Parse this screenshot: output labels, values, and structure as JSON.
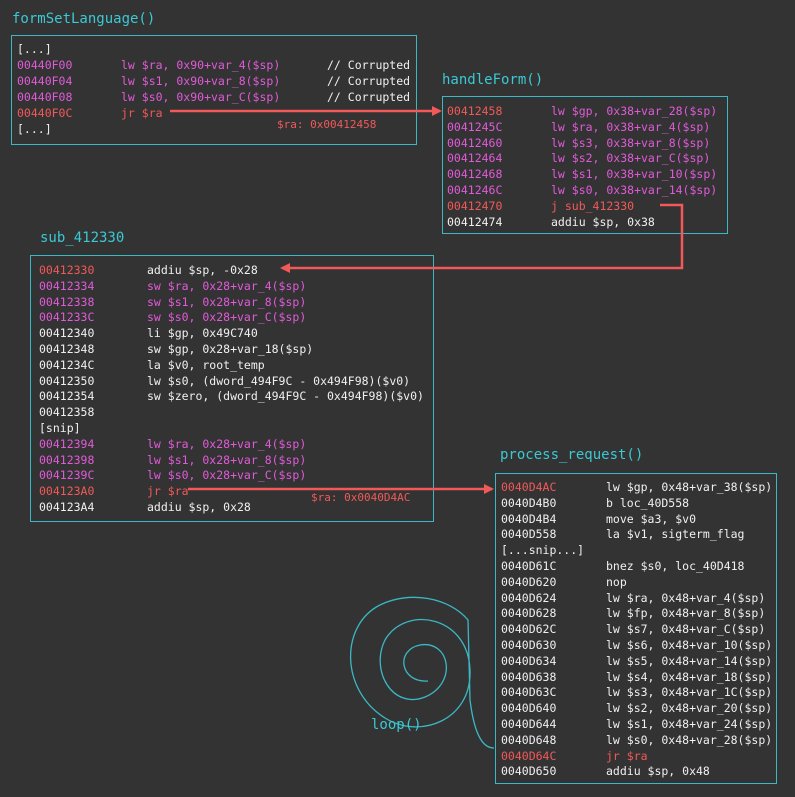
{
  "colors": {
    "white": "#f0f0f0",
    "pink": "#e15bd9",
    "red": "#f25959",
    "cyan": "#3bc9d4",
    "background": "#333333"
  },
  "blocks": {
    "formSetLanguage": {
      "title": "formSetLanguage()",
      "lines": [
        {
          "addr": "[...]",
          "instr": "",
          "color": "white"
        },
        {
          "addr": "00440F00",
          "instr": "lw $ra, 0x90+var_4($sp)",
          "color": "pink",
          "comment": "// Corrupted"
        },
        {
          "addr": "00440F04",
          "instr": "lw $s1, 0x90+var_8($sp)",
          "color": "pink",
          "comment": "// Corrupted"
        },
        {
          "addr": "00440F08",
          "instr": "lw $s0, 0x90+var_C($sp)",
          "color": "pink",
          "comment": "// Corrupted"
        },
        {
          "addr": "00440F0C",
          "instr": "jr $ra",
          "color": "red"
        },
        {
          "addr": "[...]",
          "instr": "",
          "color": "white"
        }
      ],
      "ra_label": "$ra: 0x00412458"
    },
    "handleForm": {
      "title": "handleForm()",
      "lines": [
        {
          "addr": "00412458",
          "instr": "lw $gp, 0x38+var_28($sp)",
          "color": "pink",
          "addr_color": "red"
        },
        {
          "addr": "0041245C",
          "instr": "lw $ra, 0x38+var_4($sp)",
          "color": "pink"
        },
        {
          "addr": "00412460",
          "instr": "lw $s3, 0x38+var_8($sp)",
          "color": "pink"
        },
        {
          "addr": "00412464",
          "instr": "lw $s2, 0x38+var_C($sp)",
          "color": "pink"
        },
        {
          "addr": "00412468",
          "instr": "lw $s1, 0x38+var_10($sp)",
          "color": "pink"
        },
        {
          "addr": "0041246C",
          "instr": "lw $s0, 0x38+var_14($sp)",
          "color": "pink"
        },
        {
          "addr": "00412470",
          "instr": "j sub_412330",
          "color": "red"
        },
        {
          "addr": "00412474",
          "instr": "addiu $sp, 0x38",
          "color": "white"
        }
      ]
    },
    "sub_412330": {
      "title": "sub_412330",
      "lines": [
        {
          "addr": "00412330",
          "instr": "addiu $sp, -0x28",
          "color": "white",
          "addr_color": "red"
        },
        {
          "addr": "00412334",
          "instr": "sw $ra, 0x28+var_4($sp)",
          "color": "pink"
        },
        {
          "addr": "00412338",
          "instr": "sw $s1, 0x28+var_8($sp)",
          "color": "pink"
        },
        {
          "addr": "0041233C",
          "instr": "sw $s0, 0x28+var_C($sp)",
          "color": "pink"
        },
        {
          "addr": "00412340",
          "instr": "li $gp, 0x49C740",
          "color": "white"
        },
        {
          "addr": "00412348",
          "instr": "sw $gp, 0x28+var_18($sp)",
          "color": "white"
        },
        {
          "addr": "0041234C",
          "instr": "la $v0, root_temp",
          "color": "white"
        },
        {
          "addr": "00412350",
          "instr": "lw $s0, (dword_494F9C - 0x494F98)($v0)",
          "color": "white"
        },
        {
          "addr": "00412354",
          "instr": "sw $zero, (dword_494F9C - 0x494F98)($v0)",
          "color": "white"
        },
        {
          "addr": "00412358",
          "instr": "",
          "color": "white"
        },
        {
          "addr": "[snip]",
          "instr": "",
          "color": "white"
        },
        {
          "addr": "00412394",
          "instr": "lw $ra, 0x28+var_4($sp)",
          "color": "pink"
        },
        {
          "addr": "00412398",
          "instr": "lw $s1, 0x28+var_8($sp)",
          "color": "pink"
        },
        {
          "addr": "0041239C",
          "instr": "lw $s0, 0x28+var_C($sp)",
          "color": "pink"
        },
        {
          "addr": "004123A0",
          "instr": "jr $ra",
          "color": "red"
        },
        {
          "addr": "004123A4",
          "instr": "addiu $sp, 0x28",
          "color": "white"
        }
      ],
      "ra_label": "$ra: 0x0040D4AC"
    },
    "process_request": {
      "title": "process_request()",
      "lines": [
        {
          "addr": "0040D4AC",
          "instr": "lw $gp, 0x48+var_38($sp)",
          "color": "white",
          "addr_color": "red"
        },
        {
          "addr": "0040D4B0",
          "instr": "b loc_40D558",
          "color": "white"
        },
        {
          "addr": "0040D4B4",
          "instr": "move $a3, $v0",
          "color": "white"
        },
        {
          "addr": "0040D558",
          "instr": "la $v1, sigterm_flag",
          "color": "white"
        },
        {
          "addr": "[...snip...]",
          "instr": "",
          "color": "white"
        },
        {
          "addr": "0040D61C",
          "instr": "bnez $s0, loc_40D418",
          "color": "white"
        },
        {
          "addr": "0040D620",
          "instr": "nop",
          "color": "white"
        },
        {
          "addr": "0040D624",
          "instr": "lw $ra, 0x48+var_4($sp)",
          "color": "white"
        },
        {
          "addr": "0040D628",
          "instr": "lw $fp, 0x48+var_8($sp)",
          "color": "white"
        },
        {
          "addr": "0040D62C",
          "instr": "lw $s7, 0x48+var_C($sp)",
          "color": "white"
        },
        {
          "addr": "0040D630",
          "instr": "lw $s6, 0x48+var_10($sp)",
          "color": "white"
        },
        {
          "addr": "0040D634",
          "instr": "lw $s5, 0x48+var_14($sp)",
          "color": "white"
        },
        {
          "addr": "0040D638",
          "instr": "lw $s4, 0x48+var_18($sp)",
          "color": "white"
        },
        {
          "addr": "0040D63C",
          "instr": "lw $s3, 0x48+var_1C($sp)",
          "color": "white"
        },
        {
          "addr": "0040D640",
          "instr": "lw $s2, 0x48+var_20($sp)",
          "color": "white"
        },
        {
          "addr": "0040D644",
          "instr": "lw $s1, 0x48+var_24($sp)",
          "color": "white"
        },
        {
          "addr": "0040D648",
          "instr": "lw $s0, 0x48+var_28($sp)",
          "color": "white"
        },
        {
          "addr": "0040D64C",
          "instr": "jr $ra",
          "color": "red"
        },
        {
          "addr": "0040D650",
          "instr": "addiu $sp, 0x48",
          "color": "white"
        }
      ]
    }
  },
  "loop_label": "loop()"
}
